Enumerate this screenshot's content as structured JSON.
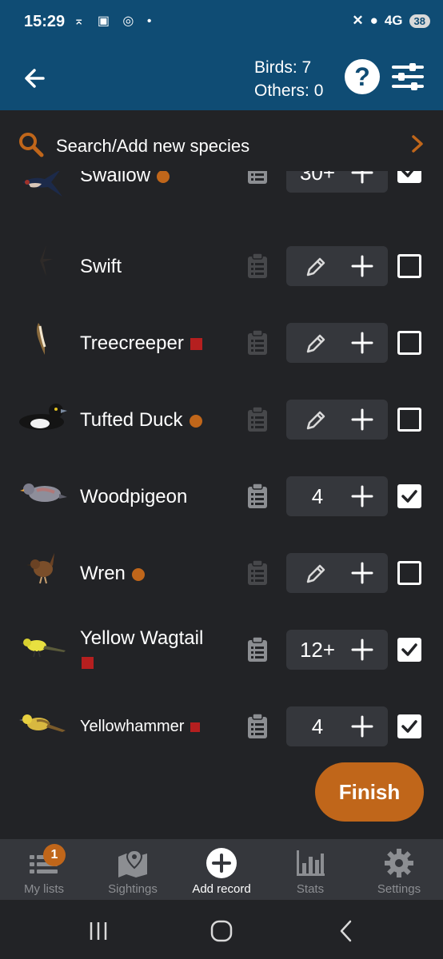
{
  "status": {
    "time": "15:29",
    "network": "4G",
    "network_sub": "LTE",
    "battery": "38"
  },
  "header": {
    "birds_label": "Birds: 7",
    "others_label": "Others: 0",
    "back_icon": "arrow-left-icon",
    "help_icon": "question-icon",
    "filter_icon": "sliders-icon"
  },
  "search": {
    "placeholder": "Search/Add new species"
  },
  "colors": {
    "primary": "#0f4c74",
    "accent": "#c0661a",
    "marker_red": "#b51f1f",
    "background": "#222326",
    "surface": "#35373c"
  },
  "species": [
    {
      "name": "Swallow",
      "marker": "dot",
      "count": "30+",
      "has_notes": true,
      "checked": true
    },
    {
      "name": "Swift",
      "marker": "none",
      "count": "",
      "has_notes": false,
      "checked": false
    },
    {
      "name": "Treecreeper",
      "marker": "square",
      "count": "",
      "has_notes": false,
      "checked": false
    },
    {
      "name": "Tufted Duck",
      "marker": "dot",
      "count": "",
      "has_notes": false,
      "checked": false
    },
    {
      "name": "Woodpigeon",
      "marker": "none",
      "count": "4",
      "has_notes": true,
      "checked": true
    },
    {
      "name": "Wren",
      "marker": "dot",
      "count": "",
      "has_notes": false,
      "checked": false
    },
    {
      "name": "Yellow Wagtail",
      "marker": "square",
      "count": "12+",
      "has_notes": true,
      "checked": true
    },
    {
      "name": "Yellowhammer",
      "marker": "square",
      "count": "4",
      "has_notes": true,
      "checked": true
    }
  ],
  "finish_label": "Finish",
  "nav": [
    {
      "label": "My lists",
      "icon": "list-icon",
      "badge": "1",
      "active": false
    },
    {
      "label": "Sightings",
      "icon": "map-pin-icon",
      "active": false
    },
    {
      "label": "Add record",
      "icon": "add-circle-icon",
      "active": true
    },
    {
      "label": "Stats",
      "icon": "bar-chart-icon",
      "active": false
    },
    {
      "label": "Settings",
      "icon": "gear-icon",
      "active": false
    }
  ]
}
